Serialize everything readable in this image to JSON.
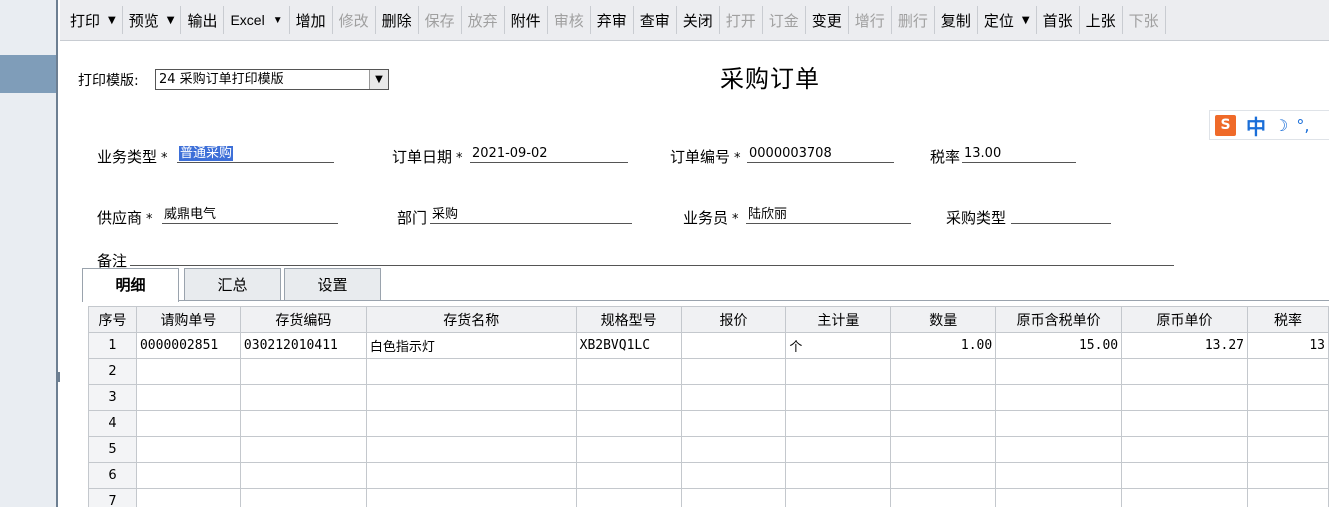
{
  "toolbar": {
    "items": [
      {
        "label": "打印",
        "dropdown": true,
        "disabled": false
      },
      {
        "label": "预览",
        "dropdown": true,
        "disabled": false
      },
      {
        "label": "输出",
        "dropdown": false,
        "disabled": false
      },
      {
        "label": "Excel",
        "dropdown": true,
        "disabled": false
      },
      {
        "label": "增加",
        "dropdown": false,
        "disabled": false
      },
      {
        "label": "修改",
        "dropdown": false,
        "disabled": true
      },
      {
        "label": "删除",
        "dropdown": false,
        "disabled": false
      },
      {
        "label": "保存",
        "dropdown": false,
        "disabled": true
      },
      {
        "label": "放弃",
        "dropdown": false,
        "disabled": true
      },
      {
        "label": "附件",
        "dropdown": false,
        "disabled": false
      },
      {
        "label": "审核",
        "dropdown": false,
        "disabled": true
      },
      {
        "label": "弃审",
        "dropdown": false,
        "disabled": false
      },
      {
        "label": "查审",
        "dropdown": false,
        "disabled": false
      },
      {
        "label": "关闭",
        "dropdown": false,
        "disabled": false
      },
      {
        "label": "打开",
        "dropdown": false,
        "disabled": true
      },
      {
        "label": "订金",
        "dropdown": false,
        "disabled": true
      },
      {
        "label": "变更",
        "dropdown": false,
        "disabled": false
      },
      {
        "label": "增行",
        "dropdown": false,
        "disabled": true
      },
      {
        "label": "删行",
        "dropdown": false,
        "disabled": true
      },
      {
        "label": "复制",
        "dropdown": false,
        "disabled": false
      },
      {
        "label": "定位",
        "dropdown": true,
        "disabled": false
      },
      {
        "label": "首张",
        "dropdown": false,
        "disabled": false
      },
      {
        "label": "上张",
        "dropdown": false,
        "disabled": false
      },
      {
        "label": "下张",
        "dropdown": false,
        "disabled": true
      }
    ]
  },
  "template": {
    "label": "打印模版:",
    "value": "24 采购订单打印模版"
  },
  "form_title": "采购订单",
  "ime": {
    "logo": "🅂",
    "zh": "中",
    "moon": "☽",
    "dots": "°,"
  },
  "header_fields": {
    "biz_type": {
      "label": "业务类型",
      "required": "*",
      "value": "普通采购"
    },
    "order_date": {
      "label": "订单日期",
      "required": "*",
      "value": "2021-09-02"
    },
    "order_no": {
      "label": "订单编号",
      "required": "*",
      "value": "0000003708"
    },
    "tax_rate": {
      "label": "税率",
      "value": "13.00"
    },
    "supplier": {
      "label": "供应商",
      "required": "*",
      "value": "威鼎电气"
    },
    "department": {
      "label": "部门",
      "value": "采购"
    },
    "salesman": {
      "label": "业务员",
      "required": "*",
      "value": "陆欣丽"
    },
    "purchase_type": {
      "label": "采购类型",
      "value": ""
    },
    "remark": {
      "label": "备注",
      "value": ""
    }
  },
  "tabs": [
    {
      "label": "明细",
      "active": true
    },
    {
      "label": "汇总",
      "active": false
    },
    {
      "label": "设置",
      "active": false
    }
  ],
  "grid": {
    "columns": [
      "序号",
      "请购单号",
      "存货编码",
      "存货名称",
      "规格型号",
      "报价",
      "主计量",
      "数量",
      "原币含税单价",
      "原币单价",
      "税率"
    ],
    "rows": [
      [
        "1",
        "0000002851",
        "030212010411",
        "白色指示灯",
        "XB2BVQ1LC",
        "",
        "个",
        "1.00",
        "15.00",
        "13.27",
        "13"
      ],
      [
        "2",
        "",
        "",
        "",
        "",
        "",
        "",
        "",
        "",
        "",
        ""
      ],
      [
        "3",
        "",
        "",
        "",
        "",
        "",
        "",
        "",
        "",
        "",
        ""
      ],
      [
        "4",
        "",
        "",
        "",
        "",
        "",
        "",
        "",
        "",
        "",
        ""
      ],
      [
        "5",
        "",
        "",
        "",
        "",
        "",
        "",
        "",
        "",
        "",
        ""
      ],
      [
        "6",
        "",
        "",
        "",
        "",
        "",
        "",
        "",
        "",
        "",
        ""
      ],
      [
        "7",
        "",
        "",
        "",
        "",
        "",
        "",
        "",
        "",
        "",
        ""
      ]
    ]
  }
}
